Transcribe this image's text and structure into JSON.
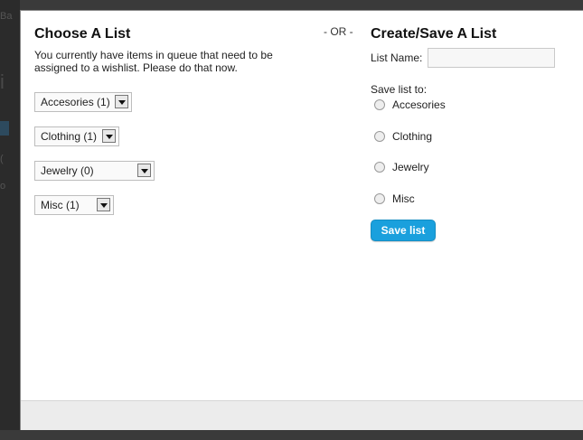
{
  "background_fragments": [
    "Ba",
    "i",
    "",
    "(",
    "o"
  ],
  "choose_list": {
    "title": "Choose A List",
    "intro": "You currently have items in queue that need to be assigned to a wishlist. Please do that now.",
    "selects": [
      {
        "selected": "Accesories (1)"
      },
      {
        "selected": "Clothing (1)"
      },
      {
        "selected": "Jewelry (0)"
      },
      {
        "selected": "Misc (1)"
      }
    ]
  },
  "separator": "- OR -",
  "create_list": {
    "title": "Create/Save A List",
    "list_name_label": "List Name:",
    "list_name_value": "",
    "save_to_label": "Save list to:",
    "options": [
      {
        "label": "Accesories"
      },
      {
        "label": "Clothing"
      },
      {
        "label": "Jewelry"
      },
      {
        "label": "Misc"
      }
    ],
    "save_button": "Save list"
  },
  "colors": {
    "overlay": "#3a3a3a",
    "dialog": "#ffffff",
    "footer": "#ececec",
    "button": "#1aa0dd"
  }
}
